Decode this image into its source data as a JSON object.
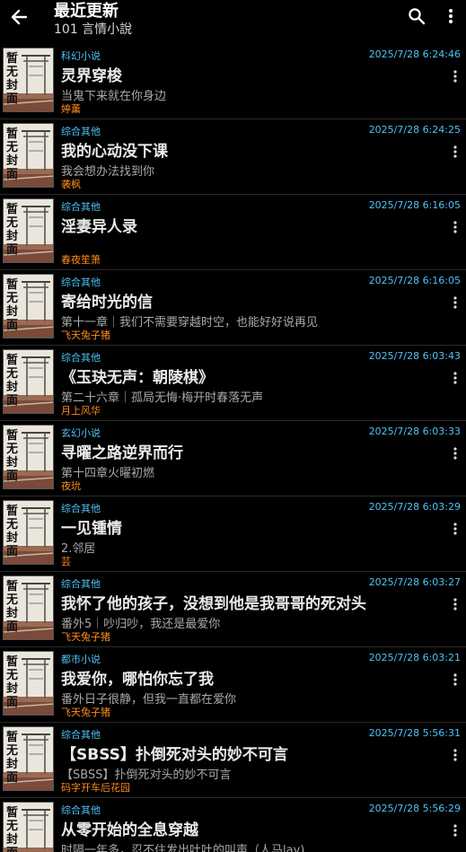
{
  "header": {
    "title": "最近更新",
    "subtitle": "101 言情小說",
    "icons": [
      "back-arrow-icon",
      "search-icon",
      "more-vert-icon"
    ]
  },
  "cover": {
    "stamp": "暂无封面"
  },
  "books": [
    {
      "category": "科幻小说",
      "time": "2025/7/28 6:24:46",
      "title": "灵界穿梭",
      "latest": "当鬼下来就在你身边",
      "author": "婷薰"
    },
    {
      "category": "综合其他",
      "time": "2025/7/28 6:24:25",
      "title": "我的心动没下课",
      "latest": "我会想办法找到你",
      "author": "袭枫"
    },
    {
      "category": "综合其他",
      "time": "2025/7/28 6:16:05",
      "title": "淫妻异人录",
      "latest": "",
      "author": "春夜笙箫"
    },
    {
      "category": "综合其他",
      "time": "2025/7/28 6:16:05",
      "title": "寄给时光的信",
      "latest": "第十一章｜我们不需要穿越时空，也能好好说再见",
      "author": "飞天兔子猪"
    },
    {
      "category": "综合其他",
      "time": "2025/7/28 6:03:43",
      "title": "《玉玦无声：朝陵棋》",
      "latest": "第二十六章｜孤局无悔·梅开时春落无声",
      "author": "月上风华"
    },
    {
      "category": "玄幻小说",
      "time": "2025/7/28 6:03:33",
      "title": "寻曜之路逆界而行",
      "latest": "第十四章火曜初燃",
      "author": "夜玧"
    },
    {
      "category": "综合其他",
      "time": "2025/7/28 6:03:29",
      "title": "一见锺情",
      "latest": "2.邻居",
      "author": "芸"
    },
    {
      "category": "综合其他",
      "time": "2025/7/28 6:03:27",
      "title": "我怀了他的孩子，没想到他是我哥哥的死对头",
      "latest": "番外5｜吵归吵，我还是最爱你",
      "author": "飞天兔子猪"
    },
    {
      "category": "都市小说",
      "time": "2025/7/28 6:03:21",
      "title": "我爱你，哪怕你忘了我",
      "latest": "番外日子很静，但我一直都在爱你",
      "author": "飞天兔子猪"
    },
    {
      "category": "综合其他",
      "time": "2025/7/28 5:56:31",
      "title": "【SBSS】扑倒死对头的妙不可言",
      "latest": "【SBSS】扑倒死对头的妙不可言",
      "author": "码字开车后花园"
    },
    {
      "category": "综合其他",
      "time": "2025/7/28 5:56:29",
      "title": "从零开始的全息穿越",
      "latest": "时隔一年多，忍不住发出吐吐的叫声（人马lay)",
      "author": ""
    }
  ]
}
